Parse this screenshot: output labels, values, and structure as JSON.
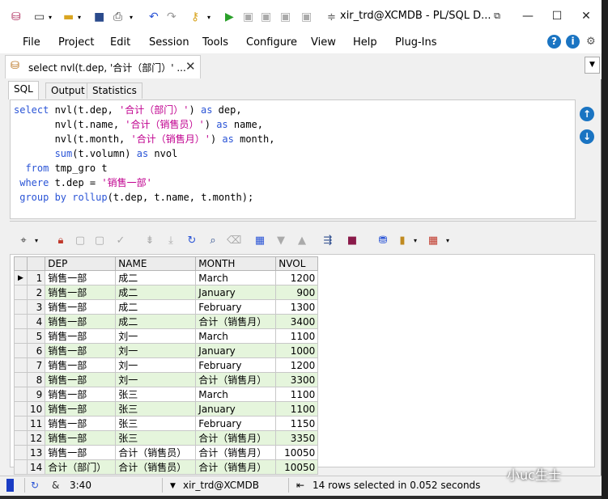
{
  "window": {
    "title": "xir_trd@XCMDB - PL/SQL D...",
    "restore_glyph": "⧉"
  },
  "menu": [
    "File",
    "Project",
    "Edit",
    "Session",
    "Tools",
    "Configure",
    "View",
    "Help",
    "Plug-Ins"
  ],
  "doc_tab": {
    "label": "select nvl(t.dep, '合计（部门）' ...",
    "close": "✕"
  },
  "inner_tabs": [
    "SQL",
    "Output",
    "Statistics"
  ],
  "sql_lines": [
    [
      [
        "kw",
        "select "
      ],
      [
        "",
        "nvl(t.dep, "
      ],
      [
        "st",
        "'合计（部门）'"
      ],
      [
        "",
        ") "
      ],
      [
        "kw",
        "as "
      ],
      [
        "",
        "dep,"
      ]
    ],
    [
      [
        "",
        "       nvl(t.name, "
      ],
      [
        "st",
        "'合计（销售员）'"
      ],
      [
        "",
        ") "
      ],
      [
        "kw",
        "as "
      ],
      [
        "",
        "name,"
      ]
    ],
    [
      [
        "",
        "       nvl(t.month, "
      ],
      [
        "st",
        "'合计（销售月）'"
      ],
      [
        "",
        ") "
      ],
      [
        "kw",
        "as "
      ],
      [
        "",
        "month,"
      ]
    ],
    [
      [
        "kw",
        "       sum"
      ],
      [
        "",
        "(t.volumn) "
      ],
      [
        "kw",
        "as "
      ],
      [
        "",
        "nvol"
      ]
    ],
    [
      [
        "kw",
        "  from "
      ],
      [
        "",
        "tmp_gro t"
      ]
    ],
    [
      [
        "kw",
        " where "
      ],
      [
        "",
        "t.dep = "
      ],
      [
        "st",
        "'销售一部'"
      ]
    ],
    [
      [
        "kw",
        " group by rollup"
      ],
      [
        "",
        "(t.dep, t.name, t.month);"
      ]
    ]
  ],
  "grid": {
    "columns": [
      "DEP",
      "NAME",
      "MONTH",
      "NVOL"
    ],
    "rows": [
      [
        "1",
        "销售一部",
        "成二",
        "March",
        "1200"
      ],
      [
        "2",
        "销售一部",
        "成二",
        "January",
        "900"
      ],
      [
        "3",
        "销售一部",
        "成二",
        "February",
        "1300"
      ],
      [
        "4",
        "销售一部",
        "成二",
        "合计（销售月）",
        "3400"
      ],
      [
        "5",
        "销售一部",
        "刘一",
        "March",
        "1100"
      ],
      [
        "6",
        "销售一部",
        "刘一",
        "January",
        "1000"
      ],
      [
        "7",
        "销售一部",
        "刘一",
        "February",
        "1200"
      ],
      [
        "8",
        "销售一部",
        "刘一",
        "合计（销售月）",
        "3300"
      ],
      [
        "9",
        "销售一部",
        "张三",
        "March",
        "1100"
      ],
      [
        "10",
        "销售一部",
        "张三",
        "January",
        "1100"
      ],
      [
        "11",
        "销售一部",
        "张三",
        "February",
        "1150"
      ],
      [
        "12",
        "销售一部",
        "张三",
        "合计（销售月）",
        "3350"
      ],
      [
        "13",
        "销售一部",
        "合计（销售员）",
        "合计（销售月）",
        "10050"
      ],
      [
        "14",
        "合计（部门）",
        "合计（销售员）",
        "合计（销售月）",
        "10050"
      ]
    ]
  },
  "status": {
    "cursor": "3:40",
    "connection": "xir_trd@XCMDB",
    "message": "14 rows selected in 0.052 seconds"
  },
  "watermark": "小uc生士",
  "colors": {
    "keyword": "#2a54d6",
    "string": "#c0008f",
    "alt_row": "#e5f5dc",
    "icon_blue": "#1a74c2"
  }
}
